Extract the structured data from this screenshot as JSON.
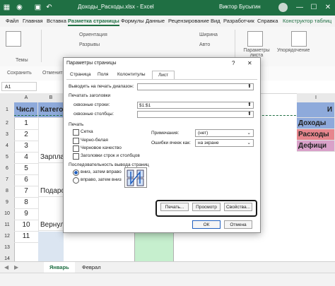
{
  "window": {
    "title": "Доходы_Расходы.xlsx  -  Excel",
    "user": "Виктор Бусыгин",
    "minimize": "—",
    "maximize": "☐",
    "close": "✕"
  },
  "ribbon_tabs": [
    "Файл",
    "Главная",
    "Вставка",
    "Разметка страницы",
    "Формулы",
    "Данные",
    "Рецензирование",
    "Вид",
    "Разработчик",
    "Справка",
    "Конструктор таблиц"
  ],
  "ribbon": {
    "themes_label": "Темы",
    "orientation": "Ориентация",
    "breaks": "Разрывы",
    "width": "Ширина",
    "fit": "Авто",
    "page_params": "Параметры листа",
    "arrange": "Упорядочение"
  },
  "quickbar": {
    "save": "Сохранить",
    "undo": "Отменить"
  },
  "namebox": "A1",
  "columns": [
    "A",
    "B",
    "I"
  ],
  "rows": [
    "1",
    "2",
    "3",
    "4",
    "5",
    "6",
    "7",
    "8",
    "9",
    "10",
    "11",
    "12",
    "13",
    "14",
    "15"
  ],
  "cells": {
    "a1": "Числ",
    "b1": "Категор",
    "n2": "1",
    "n3": "2",
    "n4": "3",
    "n5": "4",
    "n6": "5",
    "n7": "6",
    "n8": "7",
    "n9": "8",
    "n10": "9",
    "n11": "10",
    "n12": "11",
    "b5": "Зарплат",
    "b8": "Подарок",
    "b11": "Вернули",
    "i1": "И",
    "i2": "Доходы",
    "i3": "Расходы",
    "i4": "Дефици"
  },
  "sheet_tabs": {
    "active": "Январь",
    "second": "Феврал"
  },
  "dialog": {
    "title": "Параметры страницы",
    "help": "?",
    "close": "✕",
    "tabs": [
      "Страница",
      "Поля",
      "Колонтитулы",
      "Лист"
    ],
    "print_area_label": "Выводить на печать диапазон:",
    "print_area_value": "",
    "print_titles_header": "Печатать заголовки",
    "rows_label": "сквозные строки:",
    "rows_value": "$1:$1",
    "cols_label": "сквозные столбцы:",
    "cols_value": "",
    "print_header": "Печать",
    "check_grid": "Сетка",
    "check_bw": "Черно-белая",
    "check_draft": "Черновое качество",
    "check_headings": "Заголовки строк и столбцов",
    "notes_label": "Примечания:",
    "notes_value": "(нет)",
    "errors_label": "Ошибки ячеек как:",
    "errors_value": "на экране",
    "order_header": "Последовательность вывода страниц",
    "order_down": "вниз, затем вправо",
    "order_right": "вправо, затем вниз",
    "btn_print": "Печать...",
    "btn_preview": "Просмотр",
    "btn_props": "Свойства...",
    "btn_ok": "ОК",
    "btn_cancel": "Отмена"
  },
  "colors": {
    "excel_green": "#1f6f43",
    "header_blue": "#8eaadb",
    "income_blue": "#8ea9db",
    "expense_red": "#e6858d",
    "deficit_pink": "#d9a1c9",
    "light_green": "#c6efce",
    "highlight_box": "#1a1a1a"
  }
}
